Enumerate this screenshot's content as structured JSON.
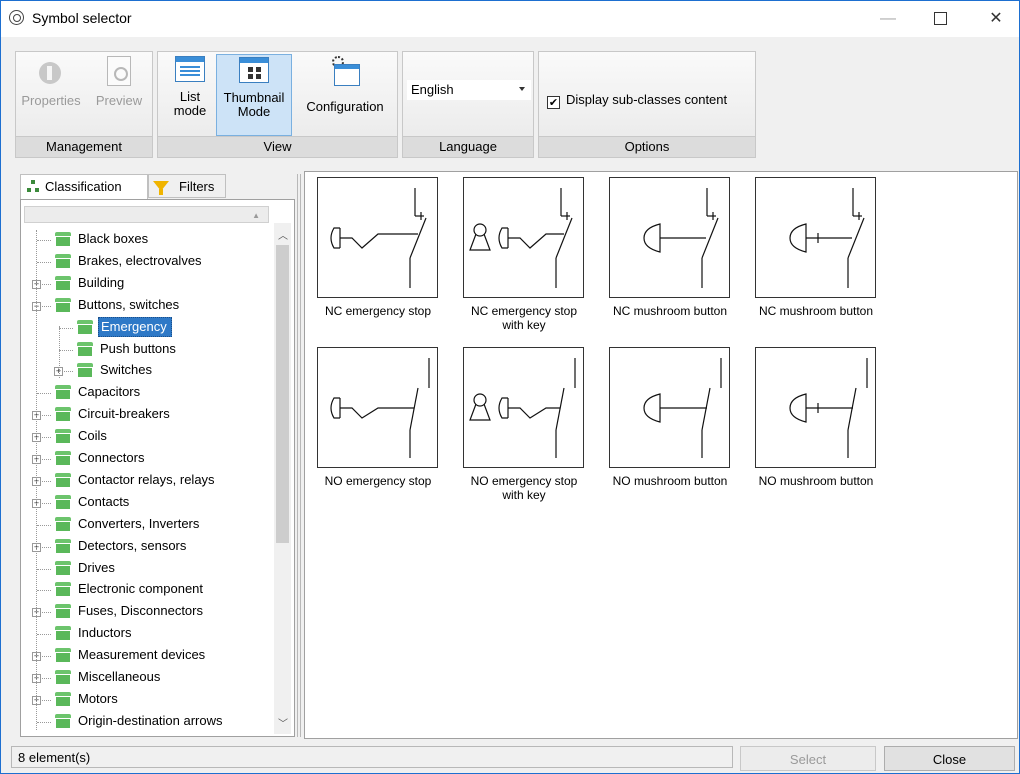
{
  "window": {
    "title": "Symbol selector",
    "minimize": "—",
    "close": "✕"
  },
  "ribbon": {
    "management": {
      "label": "Management",
      "properties": "Properties",
      "preview": "Preview"
    },
    "view": {
      "label": "View",
      "list_mode_1": "List",
      "list_mode_2": "mode",
      "thumbnail_mode_1": "Thumbnail",
      "thumbnail_mode_2": "Mode",
      "configuration": "Configuration"
    },
    "language": {
      "label": "Language",
      "selected": "English"
    },
    "options": {
      "label": "Options",
      "display_subclasses": "Display sub-classes content",
      "display_subclasses_checked": true
    }
  },
  "tabs": {
    "classification": "Classification",
    "filters": "Filters"
  },
  "tree": [
    {
      "label": "Black boxes"
    },
    {
      "label": "Brakes, electrovalves"
    },
    {
      "label": "Building"
    },
    {
      "label": "Buttons, switches"
    },
    {
      "label": "Emergency"
    },
    {
      "label": "Push buttons"
    },
    {
      "label": "Switches"
    },
    {
      "label": "Capacitors"
    },
    {
      "label": "Circuit-breakers"
    },
    {
      "label": "Coils"
    },
    {
      "label": "Connectors"
    },
    {
      "label": "Contactor relays, relays"
    },
    {
      "label": "Contacts"
    },
    {
      "label": "Converters, Inverters"
    },
    {
      "label": "Detectors, sensors"
    },
    {
      "label": "Drives"
    },
    {
      "label": "Electronic component"
    },
    {
      "label": "Fuses, Disconnectors"
    },
    {
      "label": "Inductors"
    },
    {
      "label": "Measurement devices"
    },
    {
      "label": "Miscellaneous"
    },
    {
      "label": "Motors"
    },
    {
      "label": "Origin-destination arrows"
    }
  ],
  "symbols": [
    {
      "line1": "NC emergency stop",
      "line2": ""
    },
    {
      "line1": "NC emergency stop",
      "line2": "with key"
    },
    {
      "line1": "NC mushroom button",
      "line2": ""
    },
    {
      "line1": "NC mushroom button",
      "line2": ""
    },
    {
      "line1": "NO emergency stop",
      "line2": ""
    },
    {
      "line1": "NO emergency stop",
      "line2": "with key"
    },
    {
      "line1": "NO mushroom button",
      "line2": ""
    },
    {
      "line1": "NO mushroom button",
      "line2": ""
    }
  ],
  "status": {
    "count": "8 element(s)"
  },
  "buttons": {
    "select": "Select",
    "close": "Close"
  }
}
